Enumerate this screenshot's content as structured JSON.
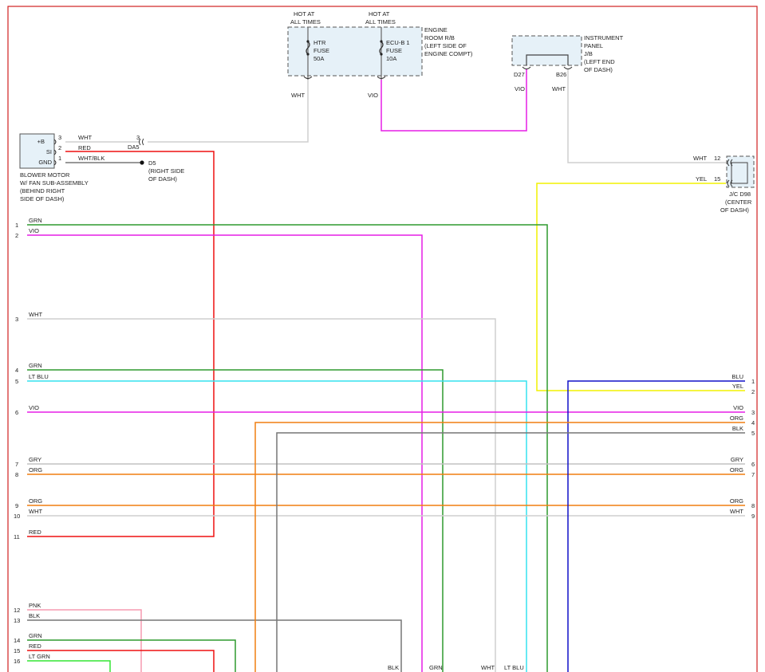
{
  "colors": {
    "WHT": "#cfcfcf",
    "RED": "#ee1111",
    "VIO": "#e61ee6",
    "GRN": "#2e9a2e",
    "LT_BLU": "#35e2ef",
    "BLU": "#1010c8",
    "YEL": "#f2f200",
    "ORG": "#f07f10",
    "BLK": "#777777",
    "GRY": "#c2c2c2",
    "PNK": "#f59ab0",
    "LT_GRN": "#33e633",
    "border": "#d02020"
  },
  "top": {
    "hot1": [
      "HOT AT",
      "ALL TIMES"
    ],
    "hot2": [
      "HOT AT",
      "ALL TIMES"
    ],
    "fuse1": [
      "HTR",
      "FUSE",
      "50A"
    ],
    "fuse2": [
      "ECU-B 1",
      "FUSE",
      "10A"
    ],
    "engine_rb": [
      "ENGINE",
      "ROOM R/B",
      "(LEFT SIDE OF",
      "ENGINE COMPT)"
    ],
    "ip_jb": [
      "INSTRUMENT",
      "PANEL",
      "J/B",
      "(LEFT END",
      "OF DASH)"
    ],
    "pin_d27": "D27",
    "pin_b26": "B26",
    "wire_wht_fuse": "WHT",
    "wire_vio_fuse": "VIO",
    "wire_vio_jb": "VIO",
    "wire_wht_jb": "WHT"
  },
  "blower": {
    "pins": [
      "+B",
      "SI",
      "GND"
    ],
    "pin_nums": [
      "3",
      "2",
      "1"
    ],
    "label": [
      "BLOWER MOTOR",
      "W/ FAN SUB-ASSEMBLY",
      "(BEHIND RIGHT",
      "SIDE OF DASH)"
    ],
    "wires": [
      "WHT",
      "RED",
      "WHT/BLK"
    ],
    "conn_pin": "3",
    "conn_name": "DA5",
    "ground": [
      "D5",
      "(RIGHT SIDE",
      "OF DASH)"
    ]
  },
  "jc": {
    "label": [
      "J/C D98",
      "(CENTER",
      "OF DASH)"
    ],
    "pins": [
      "12",
      "15"
    ],
    "wires": [
      "WHT",
      "YEL"
    ]
  },
  "left_rows": [
    {
      "n": "1",
      "w": "GRN"
    },
    {
      "n": "2",
      "w": "VIO"
    },
    {
      "n": "3",
      "w": "WHT"
    },
    {
      "n": "4",
      "w": "GRN"
    },
    {
      "n": "5",
      "w": "LT BLU"
    },
    {
      "n": "6",
      "w": "VIO"
    },
    {
      "n": "7",
      "w": "GRY"
    },
    {
      "n": "8",
      "w": "ORG"
    },
    {
      "n": "9",
      "w": "ORG"
    },
    {
      "n": "10",
      "w": "WHT"
    },
    {
      "n": "11",
      "w": "RED"
    },
    {
      "n": "12",
      "w": "PNK"
    },
    {
      "n": "13",
      "w": "BLK"
    },
    {
      "n": "14",
      "w": "GRN"
    },
    {
      "n": "15",
      "w": "RED"
    },
    {
      "n": "16",
      "w": "LT GRN"
    }
  ],
  "right_rows": [
    {
      "n": "1",
      "w": "BLU"
    },
    {
      "n": "2",
      "w": "YEL"
    },
    {
      "n": "3",
      "w": "VIO"
    },
    {
      "n": "4",
      "w": "ORG"
    },
    {
      "n": "5",
      "w": "BLK"
    },
    {
      "n": "6",
      "w": "GRY"
    },
    {
      "n": "7",
      "w": "ORG"
    },
    {
      "n": "8",
      "w": "ORG"
    },
    {
      "n": "9",
      "w": "WHT"
    }
  ],
  "bottom_labels": [
    "BLK",
    "GRN",
    "WHT",
    "LT BLU"
  ]
}
